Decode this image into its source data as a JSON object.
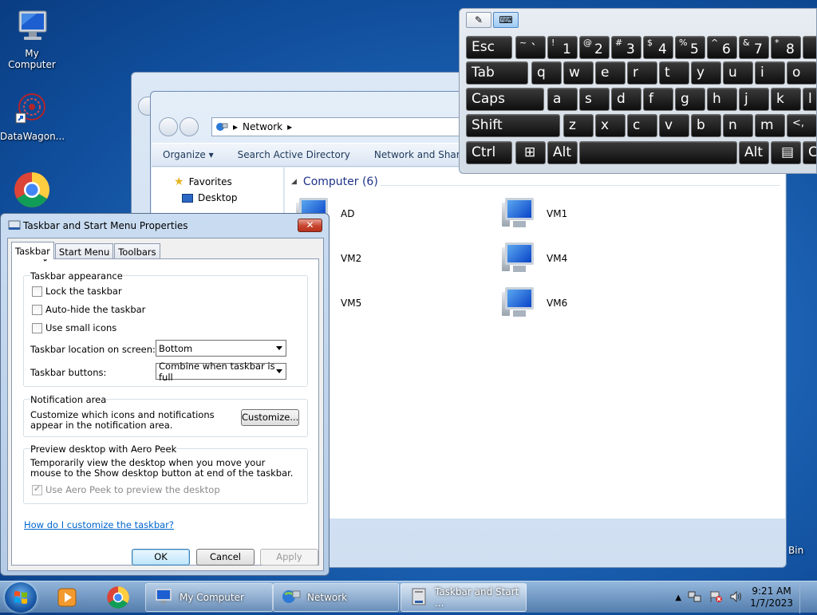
{
  "desktop": {
    "icons": [
      {
        "label": "My Computer"
      },
      {
        "label": "DataWagon..."
      },
      {
        "label": ""
      }
    ],
    "recycle_bin_partial": "Bin"
  },
  "explorer": {
    "address": {
      "segment": "Network"
    },
    "toolbar": {
      "organize": "Organize ▾",
      "search_ad": "Search Active Directory",
      "network_sharing": "Network and Sharing C"
    },
    "nav": {
      "favorites": "Favorites",
      "desktop": "Desktop"
    },
    "group_header": "Computer (6)",
    "computers": [
      "AD",
      "VM1",
      "VM2",
      "VM4",
      "VM5",
      "VM6"
    ]
  },
  "dialog": {
    "title": "Taskbar and Start Menu Properties",
    "close": "✕",
    "tabs": [
      "Taskbar",
      "Start Menu",
      "Toolbars"
    ],
    "appearance": {
      "title": "Taskbar appearance",
      "lock": "Lock the taskbar",
      "autohide": "Auto-hide the taskbar",
      "small_icons": "Use small icons",
      "location_label": "Taskbar location on screen:",
      "location_value": "Bottom",
      "buttons_label": "Taskbar buttons:",
      "buttons_value": "Combine when taskbar is full"
    },
    "notification": {
      "title": "Notification area",
      "text": "Customize which icons and notifications appear in the notification area.",
      "customize": "Customize..."
    },
    "aero": {
      "title": "Preview desktop with Aero Peek",
      "text": "Temporarily view the desktop when you move your mouse to the Show desktop button at end of the taskbar.",
      "checkbox": "Use Aero Peek to preview the desktop"
    },
    "help_link": "How do I customize the taskbar?",
    "buttons": {
      "ok": "OK",
      "cancel": "Cancel",
      "apply": "Apply"
    }
  },
  "keyboard": {
    "row1": [
      {
        "main": "Esc"
      },
      {
        "sub": "~",
        "big": "`"
      },
      {
        "sub": "!",
        "big": "1"
      },
      {
        "sub": "@",
        "big": "2"
      },
      {
        "sub": "#",
        "big": "3"
      },
      {
        "sub": "$",
        "big": "4"
      },
      {
        "sub": "%",
        "big": "5"
      },
      {
        "sub": "^",
        "big": "6"
      },
      {
        "sub": "&",
        "big": "7"
      },
      {
        "sub": "*",
        "big": "8"
      }
    ],
    "row2": [
      "Tab",
      "q",
      "w",
      "e",
      "r",
      "t",
      "y",
      "u",
      "i",
      "o"
    ],
    "row3": [
      "Caps",
      "a",
      "s",
      "d",
      "f",
      "g",
      "h",
      "j",
      "k",
      "l"
    ],
    "row4": [
      "Shift",
      "z",
      "x",
      "c",
      "v",
      "b",
      "n",
      "m",
      "<,"
    ],
    "row5": [
      "Ctrl",
      "⊞",
      "Alt",
      "",
      "Alt",
      "▤",
      "C"
    ]
  },
  "taskbar": {
    "items": [
      {
        "label": "My Computer"
      },
      {
        "label": "Network"
      },
      {
        "label": "Taskbar and Start ..."
      }
    ],
    "clock": {
      "time": "9:21 AM",
      "date": "1/7/2023"
    },
    "tray_arrow": "▲"
  }
}
